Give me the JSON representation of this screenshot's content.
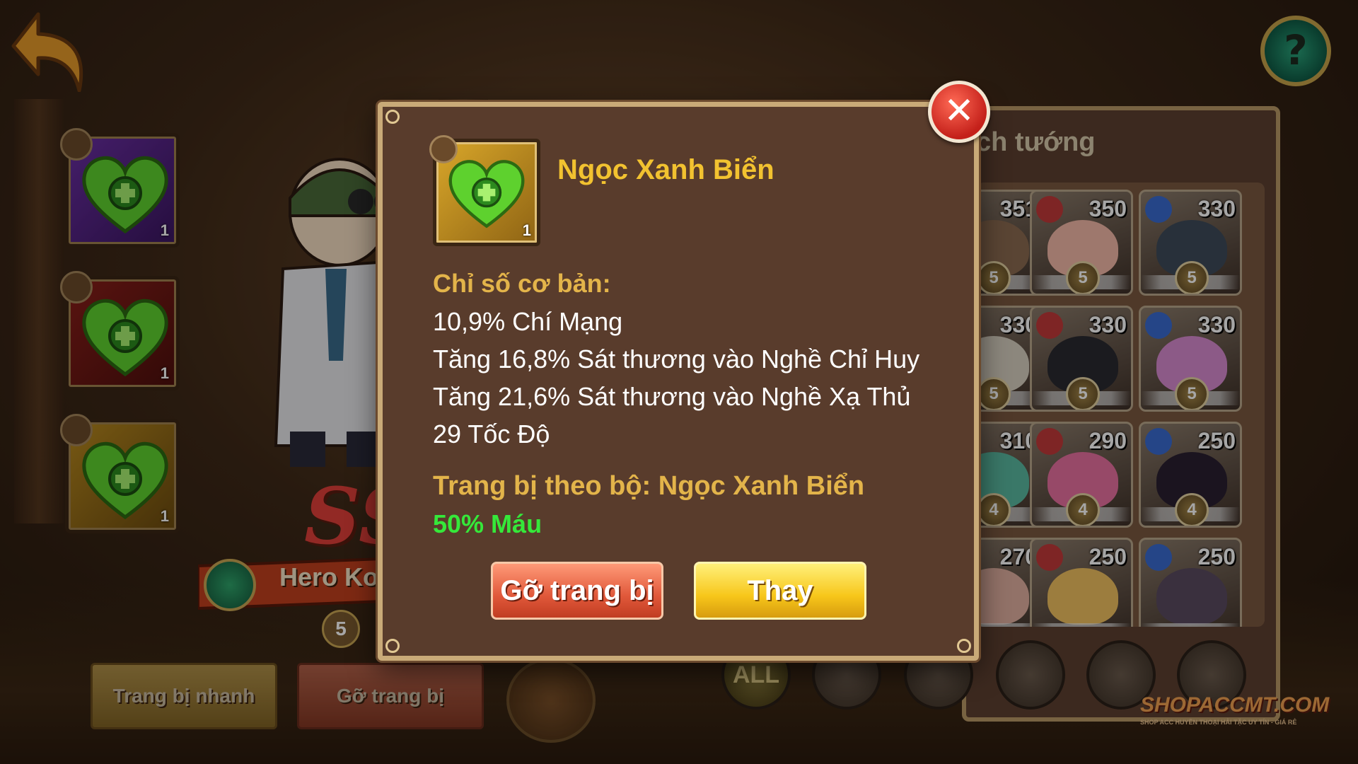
{
  "top": {
    "help_label": "?"
  },
  "gem_slots": [
    {
      "count": "1",
      "frame": "purple"
    },
    {
      "count": "1",
      "frame": "red"
    },
    {
      "count": "1",
      "frame": "gold"
    }
  ],
  "hero": {
    "name": "Hero Ko",
    "rank_text": "SS",
    "stars": "5"
  },
  "bottom_buttons": {
    "quick_equip": "Trang bị nhanh",
    "unequip_all": "Gỡ trang bị"
  },
  "hero_list": {
    "title": "ch tướng",
    "heroes": [
      {
        "power": "351",
        "stars": "5",
        "skin": "#8a6a50"
      },
      {
        "power": "350",
        "stars": "5",
        "skin": "#f3b8a8"
      },
      {
        "power": "330",
        "stars": "5",
        "skin": "#3e4a5a"
      },
      {
        "power": "330",
        "stars": "5",
        "skin": "#d8d0c0"
      },
      {
        "power": "330",
        "stars": "5",
        "skin": "#2a2a30"
      },
      {
        "power": "330",
        "stars": "5",
        "skin": "#d88ad0"
      },
      {
        "power": "310",
        "stars": "4",
        "skin": "#5ab8a0"
      },
      {
        "power": "290",
        "stars": "4",
        "skin": "#e870a0"
      },
      {
        "power": "250",
        "stars": "4",
        "skin": "#2a2030"
      },
      {
        "power": "270",
        "stars": "",
        "skin": "#e0b0a0"
      },
      {
        "power": "250",
        "stars": "",
        "skin": "#f0c060"
      },
      {
        "power": "250",
        "stars": "",
        "skin": "#5a4a60"
      }
    ],
    "filters": [
      {
        "label": "ALL",
        "icon": "all-filter"
      },
      {
        "label": "",
        "icon": "sword-icon"
      },
      {
        "label": "",
        "icon": "flag-icon"
      },
      {
        "label": "",
        "icon": "crosshair-icon"
      },
      {
        "label": "",
        "icon": "anchor-icon"
      },
      {
        "label": "",
        "icon": "helmet-icon"
      }
    ]
  },
  "modal": {
    "item_name": "Ngọc Xanh Biển",
    "item_count": "1",
    "base_stats_label": "Chỉ số cơ bản:",
    "stats": [
      "10,9% Chí Mạng",
      "Tăng 16,8% Sát thương vào Nghề Chỉ Huy",
      "Tăng 21,6% Sát thương vào Nghề Xạ Thủ",
      "29 Tốc Độ"
    ],
    "set_label": "Trang bị theo bộ: Ngọc Xanh Biển",
    "set_bonus": "50% Máu",
    "unequip_label": "Gỡ trang bị",
    "replace_label": "Thay",
    "close_label": "✕"
  },
  "watermark": {
    "main": "SHOPACCMT.COM",
    "sub": "SHOP ACC HUYỀN THOẠI HẢI TẶC UY TÍN - GIÁ RẺ"
  },
  "colors": {
    "item_name": "#f2c230",
    "set_bonus": "#35e83a",
    "label_gold": "#e3b44a"
  }
}
